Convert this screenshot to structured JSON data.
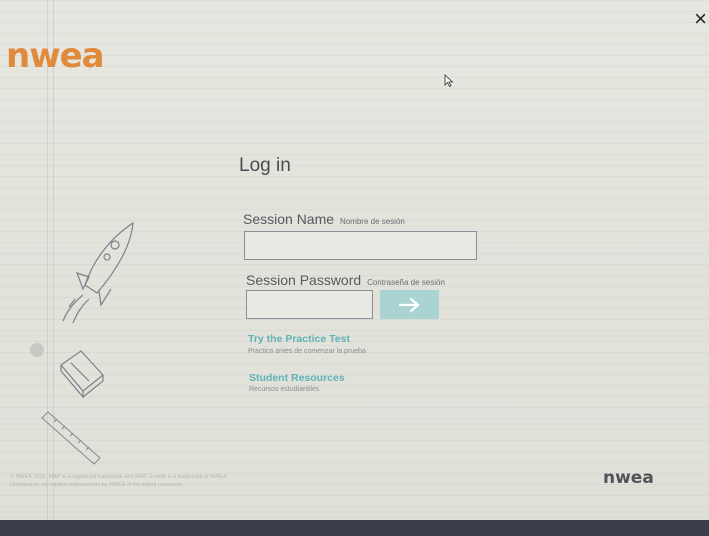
{
  "brand": {
    "logo_text": "nwea",
    "logo_color": "#e08a3c",
    "footer_logo_text": "nwea"
  },
  "window": {
    "close_label": "×"
  },
  "login": {
    "title": "Log in",
    "session_name_label": "Session Name",
    "session_name_label_es": "Nombre de sesión",
    "session_name_value": "",
    "session_password_label": "Session Password",
    "session_password_label_es": "Contraseña de sesión",
    "session_password_value": "",
    "submit_icon": "arrow-right-icon",
    "accent_color": "#a9d4d2"
  },
  "links": [
    {
      "label": "Try the Practice Test",
      "sublabel": "Practica antes de comenzar la prueba"
    },
    {
      "label": "Student Resources",
      "sublabel": "Recursos estudiantiles"
    }
  ],
  "footer": {
    "line1": "© NWEA 2015. MAP is a registered trademark and MAP Growth is a trademark of NWEA",
    "line2": "Disclosures: no implied endorsement by NWEA of the linked resources"
  }
}
